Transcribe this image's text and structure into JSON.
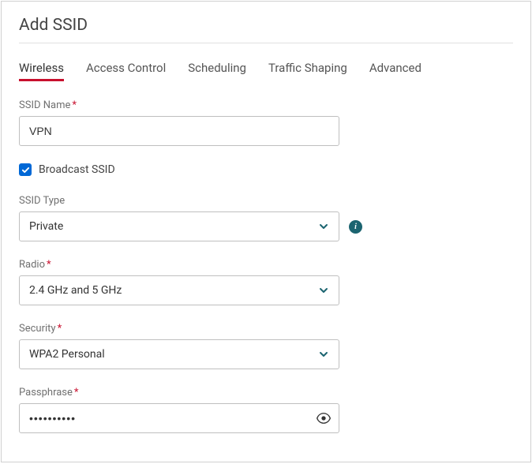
{
  "header": {
    "title": "Add SSID"
  },
  "tabs": {
    "wireless": "Wireless",
    "accessControl": "Access Control",
    "scheduling": "Scheduling",
    "trafficShaping": "Traffic Shaping",
    "advanced": "Advanced"
  },
  "form": {
    "ssidName": {
      "label": "SSID Name",
      "value": "VPN"
    },
    "broadcast": {
      "label": "Broadcast SSID",
      "checked": true
    },
    "ssidType": {
      "label": "SSID Type",
      "value": "Private"
    },
    "radio": {
      "label": "Radio",
      "value": "2.4 GHz and 5 GHz"
    },
    "security": {
      "label": "Security",
      "value": "WPA2 Personal"
    },
    "passphrase": {
      "label": "Passphrase",
      "value": "••••••••••"
    }
  }
}
